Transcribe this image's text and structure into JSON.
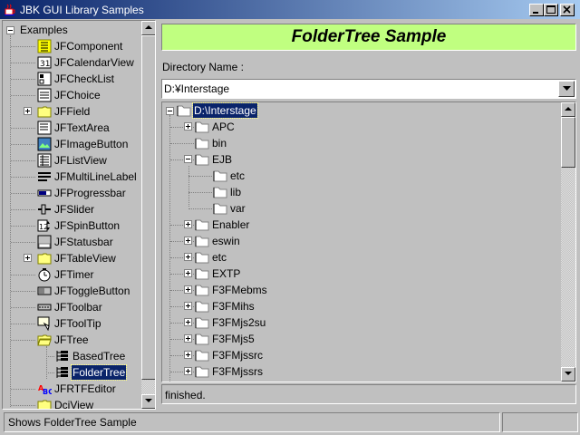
{
  "window": {
    "title": "JBK GUI Library Samples"
  },
  "left_tree": {
    "root": "Examples",
    "items": [
      {
        "label": "JFComponent",
        "icon": "component-icon"
      },
      {
        "label": "JFCalendarView",
        "icon": "calendar-icon"
      },
      {
        "label": "JFCheckList",
        "icon": "checklist-icon"
      },
      {
        "label": "JFChoice",
        "icon": "choice-icon"
      },
      {
        "label": "JFField",
        "icon": "folder-icon",
        "expandable": true
      },
      {
        "label": "JFTextArea",
        "icon": "textarea-icon"
      },
      {
        "label": "JFImageButton",
        "icon": "image-button-icon"
      },
      {
        "label": "JFListView",
        "icon": "listview-icon"
      },
      {
        "label": "JFMultiLineLabel",
        "icon": "multiline-label-icon"
      },
      {
        "label": "JFProgressbar",
        "icon": "progressbar-icon"
      },
      {
        "label": "JFSlider",
        "icon": "slider-icon"
      },
      {
        "label": "JFSpinButton",
        "icon": "spin-button-icon"
      },
      {
        "label": "JFStatusbar",
        "icon": "statusbar-icon"
      },
      {
        "label": "JFTableView",
        "icon": "folder-icon",
        "expandable": true
      },
      {
        "label": "JFTimer",
        "icon": "timer-icon"
      },
      {
        "label": "JFToggleButton",
        "icon": "toggle-button-icon"
      },
      {
        "label": "JFToolbar",
        "icon": "toolbar-icon"
      },
      {
        "label": "JFToolTip",
        "icon": "tooltip-icon"
      },
      {
        "label": "JFTree",
        "icon": "open-folder-icon",
        "expanded": true
      },
      {
        "label": "BasedTree",
        "icon": "tree-icon",
        "child": true
      },
      {
        "label": "FolderTree",
        "icon": "tree-icon",
        "child": true,
        "selected": true
      },
      {
        "label": "JFRTFEditor",
        "icon": "rtf-editor-icon"
      },
      {
        "label": "DciView",
        "icon": "folder-icon"
      }
    ]
  },
  "header": {
    "title": "FolderTree Sample"
  },
  "directory": {
    "label": "Directory Name :",
    "value": "D:¥Interstage"
  },
  "folder_tree": {
    "root": "D:\\Interstage",
    "items": [
      {
        "label": "APC",
        "level": 1,
        "expander": "plus"
      },
      {
        "label": "bin",
        "level": 1,
        "expander": "none"
      },
      {
        "label": "EJB",
        "level": 1,
        "expander": "minus"
      },
      {
        "label": "etc",
        "level": 2,
        "expander": "none"
      },
      {
        "label": "lib",
        "level": 2,
        "expander": "none"
      },
      {
        "label": "var",
        "level": 2,
        "expander": "none"
      },
      {
        "label": "Enabler",
        "level": 1,
        "expander": "plus"
      },
      {
        "label": "eswin",
        "level": 1,
        "expander": "plus"
      },
      {
        "label": "etc",
        "level": 1,
        "expander": "plus"
      },
      {
        "label": "EXTP",
        "level": 1,
        "expander": "plus"
      },
      {
        "label": "F3FMebms",
        "level": 1,
        "expander": "plus"
      },
      {
        "label": "F3FMihs",
        "level": 1,
        "expander": "plus"
      },
      {
        "label": "F3FMjs2su",
        "level": 1,
        "expander": "plus"
      },
      {
        "label": "F3FMjs5",
        "level": 1,
        "expander": "plus"
      },
      {
        "label": "F3FMjssrc",
        "level": 1,
        "expander": "plus"
      },
      {
        "label": "F3FMjssrs",
        "level": 1,
        "expander": "plus"
      }
    ]
  },
  "status": {
    "message": "finished."
  },
  "statusbar": {
    "text": "Shows FolderTree Sample"
  },
  "colors": {
    "header_bg": "#c0ff80",
    "selection": "#0a246a",
    "title_gradient_start": "#0a246a",
    "title_gradient_end": "#a6caf0"
  }
}
